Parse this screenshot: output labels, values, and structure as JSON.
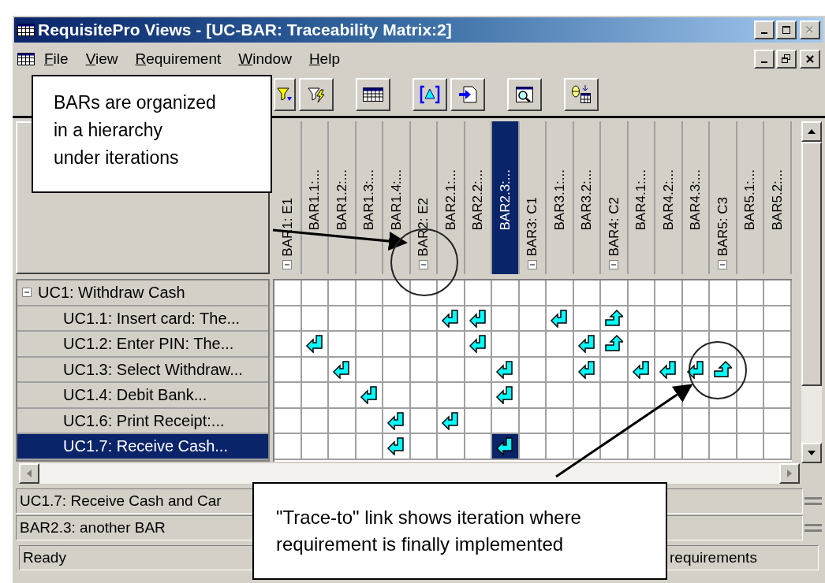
{
  "window": {
    "title": "RequisitePro Views - [UC-BAR: Traceability Matrix:2]",
    "buttons": [
      {
        "kind": "minimize",
        "disabled": false
      },
      {
        "kind": "maximize",
        "disabled": false
      },
      {
        "kind": "close",
        "disabled": true
      }
    ]
  },
  "menu": {
    "items": [
      "File",
      "View",
      "Requirement",
      "Window",
      "Help"
    ],
    "mdi_buttons": [
      {
        "kind": "minimize"
      },
      {
        "kind": "restore"
      },
      {
        "kind": "close"
      }
    ]
  },
  "toolbar": [
    {
      "kind": "filter_arrow"
    },
    {
      "kind": "filter_lightning"
    },
    {
      "kind": "table"
    },
    {
      "kind": "bracket_triangle"
    },
    {
      "kind": "import"
    },
    {
      "kind": "zoom_doc"
    },
    {
      "kind": "theta_table"
    }
  ],
  "matrix": {
    "columns": [
      {
        "label": "BAR1: E1",
        "expanded": true,
        "selected": false,
        "children": [
          {
            "label": "BAR1.1:...",
            "selected": false
          },
          {
            "label": "BAR1.2:...",
            "selected": false
          },
          {
            "label": "BAR1.3:...",
            "selected": false
          },
          {
            "label": "BAR1.4:...",
            "selected": false
          }
        ]
      },
      {
        "label": "BAR2: E2",
        "expanded": true,
        "selected": false,
        "children": [
          {
            "label": "BAR2.1:...",
            "selected": false
          },
          {
            "label": "BAR2.2:...",
            "selected": false
          },
          {
            "label": "BAR2.3:...",
            "selected": true
          }
        ]
      },
      {
        "label": "BAR3: C1",
        "expanded": true,
        "selected": false,
        "children": [
          {
            "label": "BAR3.1:...",
            "selected": false
          },
          {
            "label": "BAR3.2:...",
            "selected": false
          }
        ]
      },
      {
        "label": "BAR4: C2",
        "expanded": true,
        "selected": false,
        "children": [
          {
            "label": "BAR4.1:...",
            "selected": false
          },
          {
            "label": "BAR4.2:...",
            "selected": false
          },
          {
            "label": "BAR4.3:...",
            "selected": false
          }
        ]
      },
      {
        "label": "BAR5: C3",
        "expanded": true,
        "selected": false,
        "children": [
          {
            "label": "BAR5.1:...",
            "selected": false
          },
          {
            "label": "BAR5.2:...",
            "selected": false
          }
        ]
      }
    ],
    "rows": [
      {
        "label": "UC1: Withdraw Cash",
        "expanded": true,
        "selected": false,
        "children": [
          {
            "label": "UC1.1: Insert card:  The...",
            "selected": false,
            "cells": [
              {
                "kind": "none"
              },
              {
                "kind": "none"
              },
              {
                "kind": "none"
              },
              {
                "kind": "none"
              },
              {
                "kind": "none"
              },
              {
                "kind": "none"
              },
              {
                "kind": "from"
              },
              {
                "kind": "from"
              },
              {
                "kind": "none"
              },
              {
                "kind": "none"
              },
              {
                "kind": "from"
              },
              {
                "kind": "none"
              },
              {
                "kind": "to"
              },
              {
                "kind": "none"
              },
              {
                "kind": "none"
              },
              {
                "kind": "none"
              },
              {
                "kind": "none"
              },
              {
                "kind": "none"
              },
              {
                "kind": "none"
              }
            ]
          },
          {
            "label": "UC1.2: Enter PIN: The...",
            "selected": false,
            "cells": [
              {
                "kind": "none"
              },
              {
                "kind": "from"
              },
              {
                "kind": "none"
              },
              {
                "kind": "none"
              },
              {
                "kind": "none"
              },
              {
                "kind": "none"
              },
              {
                "kind": "none"
              },
              {
                "kind": "from"
              },
              {
                "kind": "none"
              },
              {
                "kind": "none"
              },
              {
                "kind": "none"
              },
              {
                "kind": "from"
              },
              {
                "kind": "to"
              },
              {
                "kind": "none"
              },
              {
                "kind": "none"
              },
              {
                "kind": "none"
              },
              {
                "kind": "none"
              },
              {
                "kind": "none"
              },
              {
                "kind": "none"
              }
            ]
          },
          {
            "label": "UC1.3: Select Withdraw...",
            "selected": false,
            "cells": [
              {
                "kind": "none"
              },
              {
                "kind": "none"
              },
              {
                "kind": "from"
              },
              {
                "kind": "none"
              },
              {
                "kind": "none"
              },
              {
                "kind": "none"
              },
              {
                "kind": "none"
              },
              {
                "kind": "none"
              },
              {
                "kind": "from"
              },
              {
                "kind": "none"
              },
              {
                "kind": "none"
              },
              {
                "kind": "from"
              },
              {
                "kind": "none"
              },
              {
                "kind": "from"
              },
              {
                "kind": "from"
              },
              {
                "kind": "from"
              },
              {
                "kind": "to"
              },
              {
                "kind": "none"
              },
              {
                "kind": "none"
              }
            ]
          },
          {
            "label": "UC1.4: Debit Bank...",
            "selected": false,
            "cells": [
              {
                "kind": "none"
              },
              {
                "kind": "none"
              },
              {
                "kind": "none"
              },
              {
                "kind": "from"
              },
              {
                "kind": "none"
              },
              {
                "kind": "none"
              },
              {
                "kind": "none"
              },
              {
                "kind": "none"
              },
              {
                "kind": "from"
              },
              {
                "kind": "none"
              },
              {
                "kind": "none"
              },
              {
                "kind": "none"
              },
              {
                "kind": "none"
              },
              {
                "kind": "none"
              },
              {
                "kind": "none"
              },
              {
                "kind": "none"
              },
              {
                "kind": "none"
              },
              {
                "kind": "none"
              },
              {
                "kind": "none"
              }
            ]
          },
          {
            "label": "UC1.6: Print Receipt:...",
            "selected": false,
            "cells": [
              {
                "kind": "none"
              },
              {
                "kind": "none"
              },
              {
                "kind": "none"
              },
              {
                "kind": "none"
              },
              {
                "kind": "from"
              },
              {
                "kind": "none"
              },
              {
                "kind": "from"
              },
              {
                "kind": "none"
              },
              {
                "kind": "none"
              },
              {
                "kind": "none"
              },
              {
                "kind": "none"
              },
              {
                "kind": "none"
              },
              {
                "kind": "none"
              },
              {
                "kind": "none"
              },
              {
                "kind": "none"
              },
              {
                "kind": "none"
              },
              {
                "kind": "none"
              },
              {
                "kind": "none"
              },
              {
                "kind": "none"
              }
            ]
          },
          {
            "label": "UC1.7: Receive Cash...",
            "selected": true,
            "cells": [
              {
                "kind": "none"
              },
              {
                "kind": "none"
              },
              {
                "kind": "none"
              },
              {
                "kind": "none"
              },
              {
                "kind": "from"
              },
              {
                "kind": "none"
              },
              {
                "kind": "none"
              },
              {
                "kind": "none"
              },
              {
                "kind": "from"
              },
              {
                "kind": "none"
              },
              {
                "kind": "none"
              },
              {
                "kind": "none"
              },
              {
                "kind": "none"
              },
              {
                "kind": "none"
              },
              {
                "kind": "none"
              },
              {
                "kind": "none"
              },
              {
                "kind": "none"
              },
              {
                "kind": "none"
              },
              {
                "kind": "none"
              }
            ]
          }
        ]
      }
    ]
  },
  "panes": [
    "UC1.7: Receive Cash and Car",
    "BAR2.3: another BAR"
  ],
  "status_bar": [
    "Ready",
    "requirements"
  ],
  "callouts": [
    {
      "text": "BARs are organized\nin a hierarchy\nunder iterations"
    },
    {
      "text": "\"Trace-to\" link shows iteration where requirement is finally implemented"
    }
  ]
}
